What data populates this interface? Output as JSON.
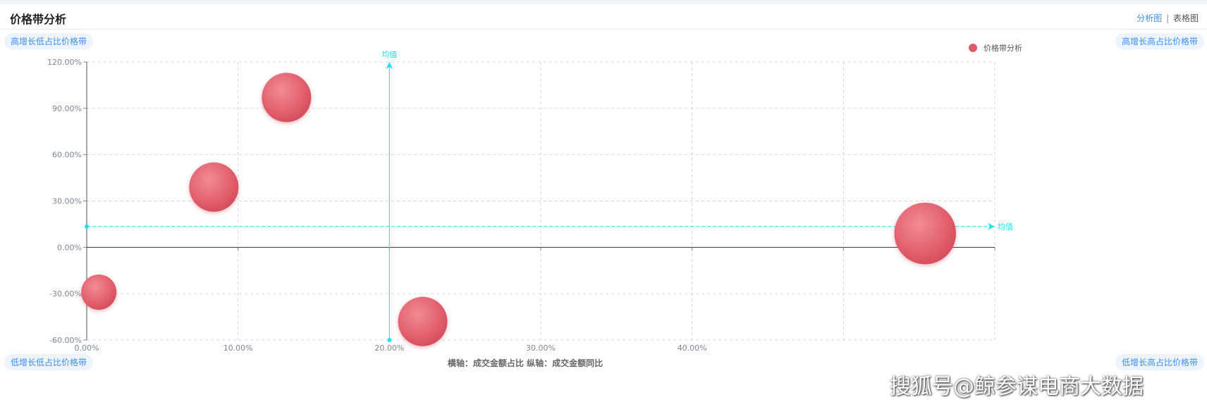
{
  "header": {
    "title": "价格带分析",
    "view_active": "分析图",
    "view_separator": "|",
    "view_inactive": "表格图"
  },
  "quadrants": {
    "top_left": "高增长低占比价格带",
    "top_right": "高增长高占比价格带",
    "bottom_left": "低增长低占比价格带",
    "bottom_right": "低增长高占比价格带"
  },
  "watermark": "搜狐号@鲸参谋电商大数据",
  "chart_data": {
    "type": "scatter",
    "title": "",
    "xlabel": "横轴：成交金额占比  纵轴：成交金额同比",
    "ylabel": "",
    "xlim": [
      0,
      60
    ],
    "ylim": [
      -60,
      120
    ],
    "x_ticks": [
      "0.00%",
      "10.00%",
      "20.00%",
      "30.00%",
      "40.00%"
    ],
    "y_ticks": [
      "-60.00%",
      "-30.00%",
      "0.00%",
      "30.00%",
      "60.00%",
      "90.00%",
      "120.00%"
    ],
    "x_tick_values": [
      0,
      10,
      20,
      30,
      40,
      50,
      60
    ],
    "y_tick_values": [
      -60,
      -30,
      0,
      30,
      60,
      90,
      120
    ],
    "grid": true,
    "legend_position": "top-right",
    "series": [
      {
        "name": "价格带分析",
        "color": "#e05a68",
        "points": [
          {
            "x": 0.8,
            "y": -29,
            "size": 1.0
          },
          {
            "x": 8.4,
            "y": 39,
            "size": 1.4
          },
          {
            "x": 13.2,
            "y": 97,
            "size": 1.4
          },
          {
            "x": 22.2,
            "y": -48,
            "size": 1.4
          },
          {
            "x": 55.4,
            "y": 9,
            "size": 1.75
          }
        ]
      }
    ],
    "mean_lines": {
      "x_mean": 20,
      "y_mean": 13.5,
      "label": "均值",
      "color": "#1ee0f0"
    }
  }
}
